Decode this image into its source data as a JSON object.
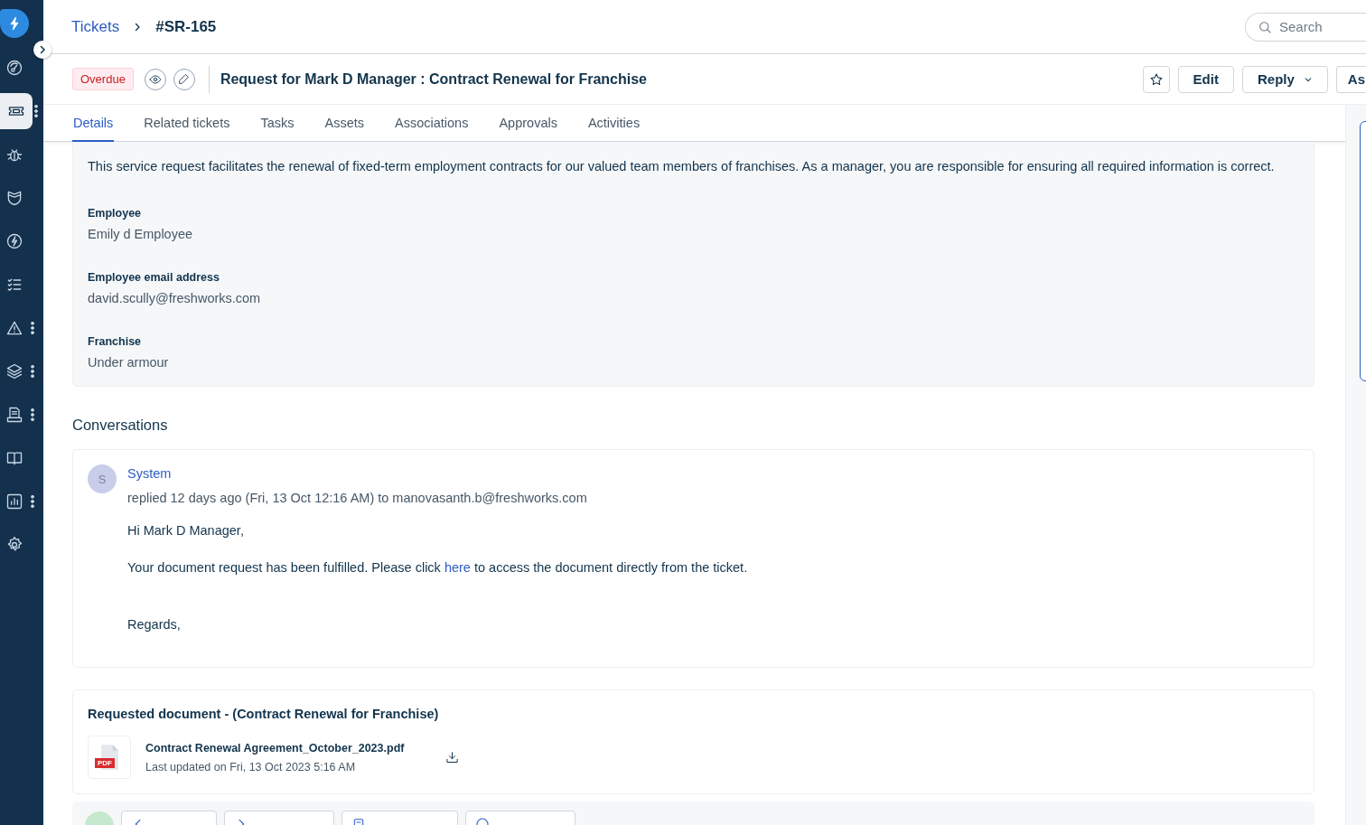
{
  "sidebar": {
    "items": [
      {
        "selected": false,
        "menu": false
      },
      {
        "selected": true,
        "menu": true
      },
      {
        "selected": false,
        "menu": false
      },
      {
        "selected": false,
        "menu": false
      },
      {
        "selected": false,
        "menu": false
      },
      {
        "selected": false,
        "menu": false
      },
      {
        "selected": false,
        "menu": true
      },
      {
        "selected": false,
        "menu": true
      },
      {
        "selected": false,
        "menu": true
      },
      {
        "selected": false,
        "menu": false
      },
      {
        "selected": false,
        "menu": true
      },
      {
        "selected": false,
        "menu": false
      }
    ]
  },
  "breadcrumb": {
    "parent": "Tickets",
    "current": "#SR-165"
  },
  "search": {
    "placeholder": "Search"
  },
  "ticket": {
    "status": "Overdue",
    "title": "Request for Mark D Manager : Contract Renewal for Franchise",
    "actions": [
      {
        "label": "Edit",
        "kind": "plain"
      },
      {
        "label": "Reply",
        "kind": "dropdown"
      },
      {
        "label": "As",
        "kind": "plain"
      }
    ]
  },
  "tabs": [
    {
      "label": "Details",
      "selected": true
    },
    {
      "label": "Related tickets",
      "selected": false
    },
    {
      "label": "Tasks",
      "selected": false
    },
    {
      "label": "Assets",
      "selected": false
    },
    {
      "label": "Associations",
      "selected": false
    },
    {
      "label": "Approvals",
      "selected": false
    },
    {
      "label": "Activities",
      "selected": false
    }
  ],
  "details": {
    "description": "This service request facilitates the renewal of fixed-term employment contracts for our valued team members of franchises. As a manager, you are responsible for ensuring all required information is correct.",
    "fields": [
      {
        "label": "Employee",
        "value": "Emily d Employee"
      },
      {
        "label": "Employee email address",
        "value": "david.scully@freshworks.com"
      },
      {
        "label": "Franchise",
        "value": "Under armour"
      }
    ]
  },
  "conversations": {
    "heading": "Conversations",
    "messages": [
      {
        "avatar": "S",
        "author": "System",
        "meta": "replied 12 days ago (Fri, 13 Oct 12:16 AM) to manovasanth.b@freshworks.com",
        "lines": [
          {
            "kind": "text",
            "text": "Hi Mark D Manager,"
          },
          {
            "kind": "link",
            "before": "Your document request has been fulfilled. Please click ",
            "link": "here",
            "after": " to access the document directly from the ticket."
          },
          {
            "kind": "text",
            "text": "Regards,"
          }
        ]
      }
    ]
  },
  "document": {
    "heading": "Requested document - (Contract Renewal for Franchise)",
    "badge": "PDF",
    "file": "Contract Renewal Agreement_October_2023.pdf",
    "updated": "Last updated on Fri, 13 Oct 2023 5:16 AM"
  }
}
